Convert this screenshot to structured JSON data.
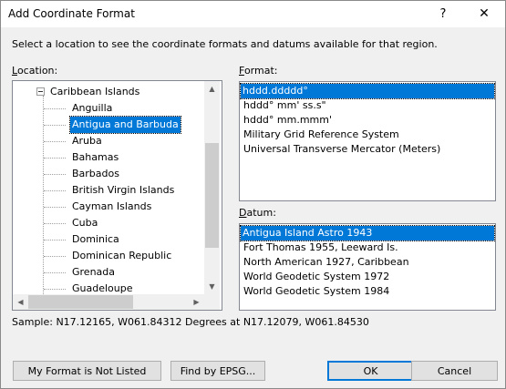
{
  "dialog": {
    "title": "Add Coordinate Format",
    "help_glyph": "?",
    "close_glyph": "✕",
    "instructions": "Select a location to see the coordinate formats and datums available for that region.",
    "sample": "Sample: N17.12165, W061.84312 Degrees at N17.12079, W061.84530"
  },
  "location": {
    "label_first": "L",
    "label_rest": "ocation:",
    "parent": "Caribbean Islands",
    "items": [
      "Anguilla",
      "Antigua and Barbuda",
      "Aruba",
      "Bahamas",
      "Barbados",
      "British Virgin Islands",
      "Cayman Islands",
      "Cuba",
      "Dominica",
      "Dominican Republic",
      "Grenada",
      "Guadeloupe"
    ],
    "selected": "Antigua and Barbuda"
  },
  "format": {
    "label_first": "F",
    "label_rest": "ormat:",
    "items": [
      "hddd.ddddd°",
      "hddd° mm' ss.s\"",
      "hddd° mm.mmm'",
      "Military Grid Reference System",
      "Universal Transverse Mercator (Meters)"
    ],
    "selected": "hddd.ddddd°"
  },
  "datum": {
    "label_first": "D",
    "label_rest": "atum:",
    "items": [
      "Antigua Island Astro 1943",
      "Fort Thomas 1955, Leeward Is.",
      "North American 1927, Caribbean",
      "World Geodetic System 1972",
      "World Geodetic System 1984"
    ],
    "selected": "Antigua Island Astro 1943"
  },
  "buttons": {
    "not_listed": "My Format is Not Listed",
    "find_epsg": "Find by EPSG...",
    "ok": "OK",
    "cancel": "Cancel"
  },
  "icons": {
    "scroll_up": "▲",
    "scroll_down": "▼",
    "scroll_left": "◀",
    "scroll_right": "▶"
  },
  "colors": {
    "selection": "#0078d7",
    "border": "#828790"
  }
}
